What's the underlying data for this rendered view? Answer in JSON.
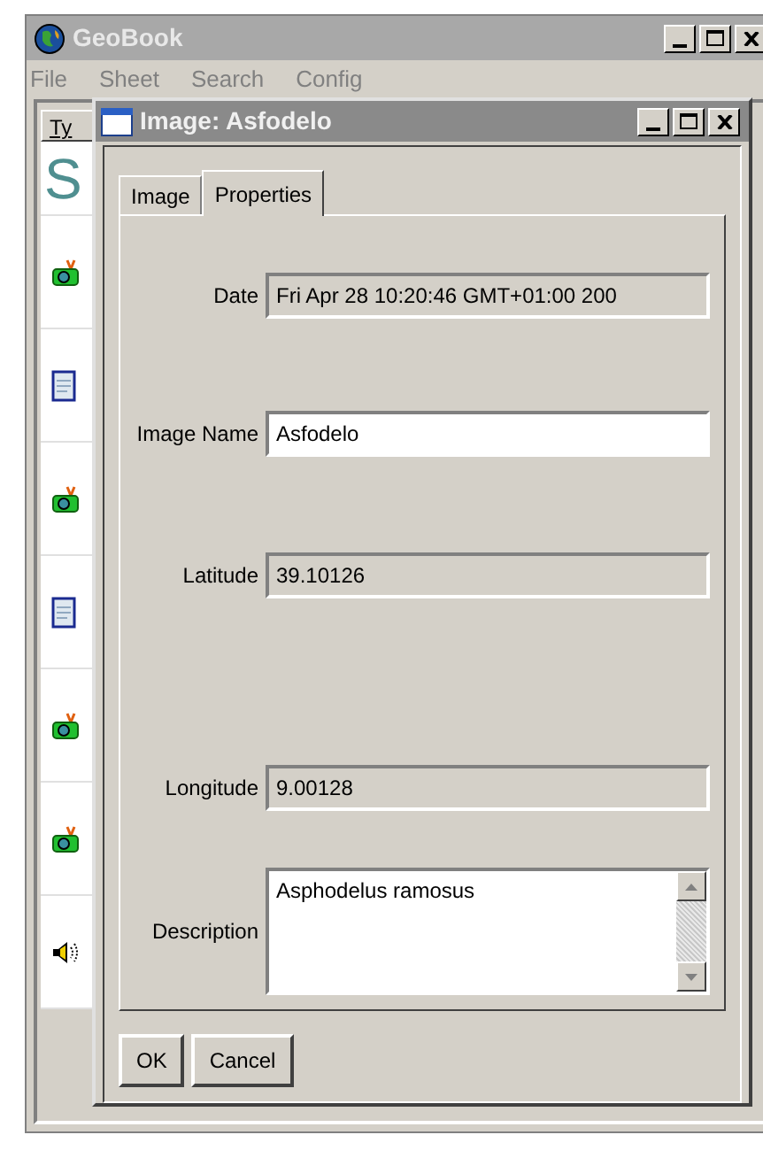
{
  "main_window": {
    "title": "GeoBook",
    "menu": [
      "File",
      "Sheet",
      "Search",
      "Config"
    ],
    "list": {
      "header": "Ty",
      "heading": "S",
      "rows": [
        {
          "kind": "camera"
        },
        {
          "kind": "document"
        },
        {
          "kind": "camera"
        },
        {
          "kind": "document"
        },
        {
          "kind": "camera"
        },
        {
          "kind": "camera"
        },
        {
          "kind": "sound"
        }
      ]
    }
  },
  "dialog": {
    "title": "Image: Asfodelo",
    "tabs": [
      {
        "label": "Image",
        "selected": false
      },
      {
        "label": "Properties",
        "selected": true
      }
    ],
    "fields": [
      {
        "kind": "line",
        "label": "Date",
        "value": "Fri Apr 28 10:20:46 GMT+01:00 200",
        "editable": false
      },
      {
        "kind": "line",
        "label": "Image Name",
        "value": "Asfodelo",
        "editable": true
      },
      {
        "kind": "line",
        "label": "Latitude",
        "value": "39.10126",
        "editable": false
      },
      {
        "kind": "line",
        "label": "Longitude",
        "value": "9.00128",
        "editable": false
      },
      {
        "kind": "text",
        "label": "Description",
        "value": "Asphodelus ramosus",
        "editable": true
      }
    ],
    "buttons": [
      "OK",
      "Cancel"
    ]
  }
}
